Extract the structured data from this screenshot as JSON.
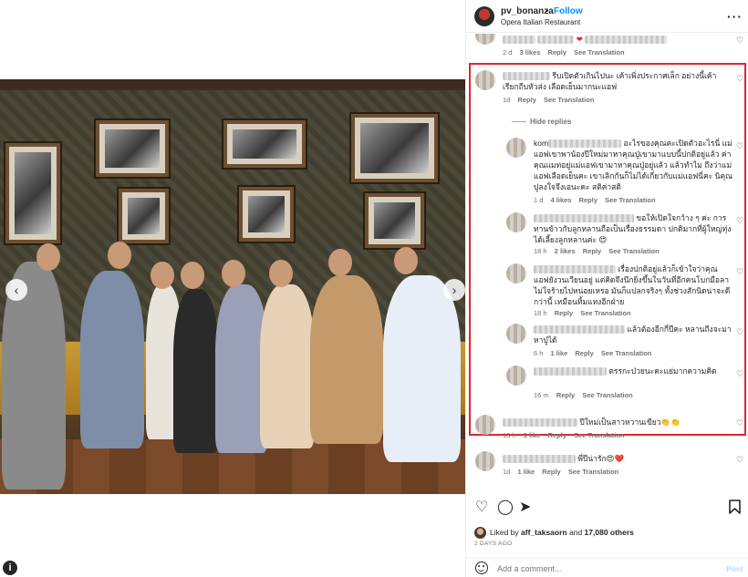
{
  "header": {
    "username": "pv_bonanza",
    "separator": "•",
    "follow_label": "Follow",
    "location": "Opera Italian Restaurant",
    "more_icon": "more-horizontal-icon"
  },
  "comments": [
    {
      "text": "",
      "meta": {
        "time": "2 d",
        "likes": "3 likes",
        "reply": "Reply",
        "translate": "See Translation"
      }
    },
    {
      "text": "รีบเปิดตัวเกินไปนะ เค้าเพิ่งประกาศเล็ก อย่างนี้เค้าเรียกถีบหัวส่ง เลือดเย็นมากนะแอฟ",
      "meta": {
        "time": "1d",
        "reply": "Reply",
        "translate": "See Translation"
      }
    }
  ],
  "hide_replies_label": "Hide replies",
  "replies": [
    {
      "prefix": "kom",
      "text": "อะไรของคุณคะเปิดตัวอะไรนี่ แม่แอฟเขาพาน้องปีใหม่มาหาคุณปู่เขามาแบบนี้ปกติอยู่แล้ว ค่าคุณแมทอยู่แม่แอฟเขามาหาคุณปู่อยู่แล้ว แล้วทำไม ถึงว่าแม่แอฟเลือดเย็นคะ เขาเลิกกันก็ไม่ได้เกี่ยวกับแม่แอฟนี่คะ นิคุณปูลงใจจึงเอนะคะ สติค่าสติ",
      "meta": {
        "time": "1 d",
        "likes": "4 likes",
        "reply": "Reply",
        "translate": "See Translation"
      }
    },
    {
      "text": "ขอให้เปิดใจกว้าง ๆ ค่ะ การทานข้าวกับลูกหลานถือเป็นเรื่องธรรมดา ปกติมากที่ผู้ใหญ่ทุ่งได้เลี้ยงลูกหลานค่ะ 😍",
      "meta": {
        "time": "18 h",
        "likes": "2 likes",
        "reply": "Reply",
        "translate": "See Translation"
      }
    },
    {
      "text": "เรื่องปกติอยู่แล้วก็เข้าใจว่าคุณแอฟยังวนเวียนอยู่ แต่คิดจึงนึกยิ่งขึ้นในวันที่อีกคนโบกมือลา ไม่ใจร้ายไปหน่อยเหรอ มันก็แปลกจริงๆ ทั้งช่วงสักนิดน่าจะดีกว่านี้ เหมือนทิ้มแทงอีกฝ่าย",
      "meta": {
        "time": "18 h",
        "reply": "Reply",
        "translate": "See Translation"
      }
    },
    {
      "text": "แล้วต้องอีกกี่ปีคะ หลานถึงจะมาหาปู่ได้",
      "meta": {
        "time": "6 h",
        "likes": "1 like",
        "reply": "Reply",
        "translate": "See Translation"
      }
    },
    {
      "text": "ตรรกะป่วยนะคะแย่มากความคิด",
      "meta": {
        "time": "16 m",
        "reply": "Reply",
        "translate": "See Translation"
      }
    }
  ],
  "after_comments": [
    {
      "text": "ปีใหม่เป็นสาวหวานเขียว👏👏",
      "meta": {
        "time": "18 h",
        "likes": "1 like",
        "reply": "Reply",
        "translate": "See Translation"
      }
    },
    {
      "text": "พี่ปีน่ารัก😍❤️",
      "meta": {
        "time": "1d",
        "likes": "1 like",
        "reply": "Reply",
        "translate": "See Translation"
      }
    }
  ],
  "actions": {
    "like_icon": "heart-icon",
    "comment_icon": "comment-icon",
    "share_icon": "send-icon",
    "save_icon": "bookmark-icon"
  },
  "likes": {
    "prefix": "Liked by",
    "user": "aff_taksaorn",
    "connector": "and",
    "count": "17,080 others"
  },
  "post_date": "2 DAYS AGO",
  "composer": {
    "placeholder": "Add a comment...",
    "post_label": "Post"
  }
}
